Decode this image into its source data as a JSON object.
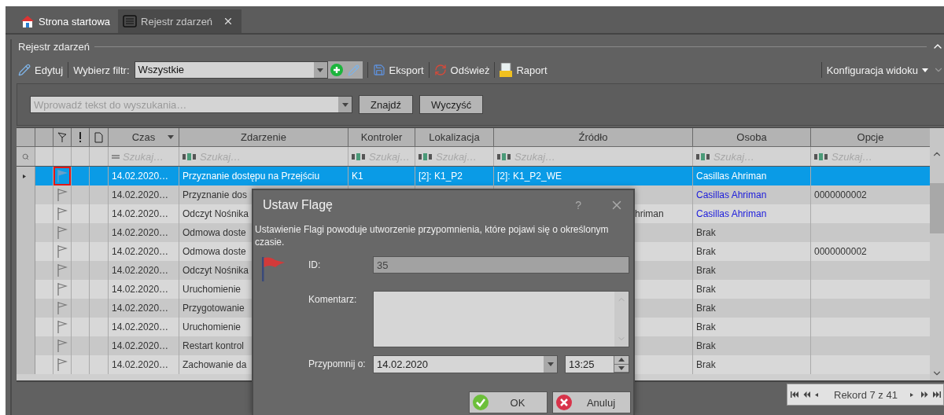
{
  "tabs": [
    {
      "label": "Strona startowa",
      "selected": false,
      "kind": "home"
    },
    {
      "label": "Rejestr zdarzeń",
      "selected": true,
      "kind": "register"
    }
  ],
  "group_title": "Rejestr zdarzeń",
  "toolbar": {
    "edit": "Edytuj",
    "filter_label": "Wybierz filtr:",
    "filter_value": "Wszystkie",
    "export": "Eksport",
    "refresh": "Odśwież",
    "report": "Raport",
    "view_config": "Konfiguracja widoku"
  },
  "search": {
    "placeholder": "Wprowadź tekst do wyszukania…",
    "find": "Znajdź",
    "clear": "Wyczyść"
  },
  "table": {
    "columns": [
      {
        "label": "Czas",
        "sorted_descending": true,
        "kind": "date",
        "filter_placeholder": "Szukaj…"
      },
      {
        "label": "Zdarzenie",
        "sorted_descending": false,
        "kind": "text",
        "filter_placeholder": "Szukaj…"
      },
      {
        "label": "Kontroler",
        "sorted_descending": false,
        "kind": "text",
        "filter_placeholder": "Szukaj…"
      },
      {
        "label": "Lokalizacja",
        "sorted_descending": false,
        "kind": "text",
        "filter_placeholder": "Szukaj…"
      },
      {
        "label": "Źródło",
        "sorted_descending": false,
        "kind": "text",
        "filter_placeholder": "Szukaj…"
      },
      {
        "label": "Osoba",
        "sorted_descending": false,
        "kind": "text",
        "filter_placeholder": "Szukaj…"
      },
      {
        "label": "Opcje",
        "sorted_descending": false,
        "kind": "text",
        "filter_placeholder": "Szukaj…"
      }
    ],
    "rows": [
      {
        "selected": true,
        "flag_highlighted": true,
        "time": "14.02.2020…",
        "event": "Przyznanie dostępu na Przejściu",
        "controller": "K1",
        "location": "[2]: K1_P2",
        "source": "[2]: K1_P2_WE",
        "person": "Casillas Ahriman",
        "person_link": false
      },
      {
        "selected": false,
        "flag_highlighted": false,
        "time": "14.02.2020…",
        "event": "Przyznanie dos",
        "person": "Casillas Ahriman",
        "person_link": true,
        "options": "0000000002"
      },
      {
        "selected": false,
        "flag_highlighted": false,
        "time": "14.02.2020…",
        "event": "Odczyt Nośnika",
        "source": "hriman",
        "person": "Casillas Ahriman",
        "person_link": true
      },
      {
        "selected": false,
        "flag_highlighted": false,
        "time": "14.02.2020…",
        "event": "Odmowa doste",
        "person": "Brak",
        "person_link": false
      },
      {
        "selected": false,
        "flag_highlighted": false,
        "time": "14.02.2020…",
        "event": "Odmowa doste",
        "person": "Brak",
        "person_link": false,
        "options": "0000000002"
      },
      {
        "selected": false,
        "flag_highlighted": false,
        "time": "14.02.2020…",
        "event": "Odczyt Nośnika",
        "person": "Brak",
        "person_link": false
      },
      {
        "selected": false,
        "flag_highlighted": false,
        "time": "14.02.2020…",
        "event": "Uruchomienie",
        "person": "Brak",
        "person_link": false
      },
      {
        "selected": false,
        "flag_highlighted": false,
        "time": "14.02.2020…",
        "event": "Przygotowanie",
        "person": "Brak",
        "person_link": false
      },
      {
        "selected": false,
        "flag_highlighted": false,
        "time": "14.02.2020…",
        "event": "Uruchomienie",
        "person": "Brak",
        "person_link": false
      },
      {
        "selected": false,
        "flag_highlighted": false,
        "time": "14.02.2020…",
        "event": "Restart kontrol",
        "person": "Brak",
        "person_link": false
      },
      {
        "selected": false,
        "flag_highlighted": false,
        "time": "14.02.2020…",
        "event": "Zachowanie da",
        "person": "Brak",
        "person_link": false
      }
    ]
  },
  "pager": {
    "label": "Rekord 7 z 41"
  },
  "dialog": {
    "title": "Ustaw Flagę",
    "help": "?",
    "description": "Ustawienie Flagi powoduje utworzenie przypomnienia, które pojawi się o określonym czasie.",
    "id_label": "ID:",
    "id_value": "35",
    "comment_label": "Komentarz:",
    "remind_label": "Przypomnij o:",
    "date": "14.02.2020",
    "time": "13:25",
    "buttons": [
      {
        "label": "OK",
        "kind": "ok"
      },
      {
        "label": "Anuluj",
        "kind": "cancel"
      }
    ]
  }
}
